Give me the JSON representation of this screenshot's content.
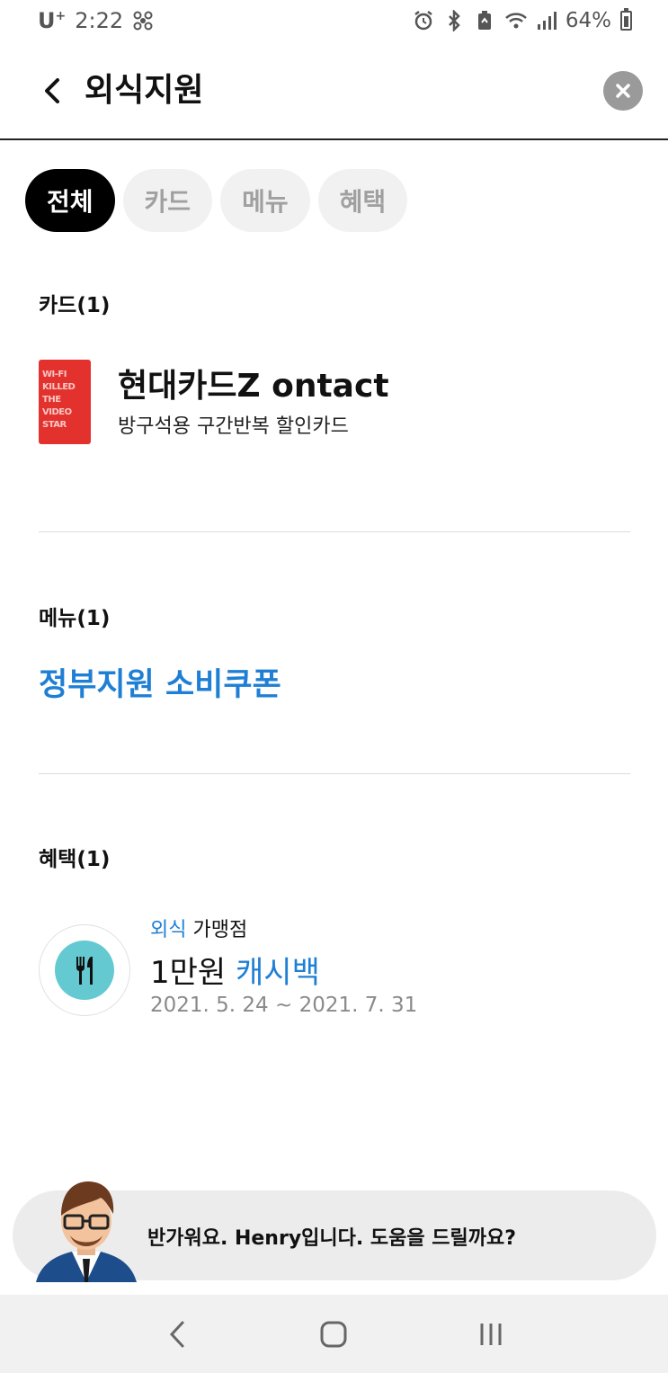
{
  "status_bar": {
    "carrier": "U",
    "carrier_sup": "+",
    "time": "2:22",
    "battery": "64%"
  },
  "header": {
    "title": "외식지원"
  },
  "tabs": [
    {
      "label": "전체",
      "active": true
    },
    {
      "label": "카드",
      "active": false
    },
    {
      "label": "메뉴",
      "active": false
    },
    {
      "label": "혜택",
      "active": false
    }
  ],
  "card_section": {
    "label": "카드(1)",
    "card_art_lines": [
      "WI-FI",
      "KILLED",
      "THE",
      "VIDEO",
      "STAR"
    ],
    "card_name": "현대카드Z ontact",
    "card_desc": "방구석용 구간반복 할인카드"
  },
  "menu_section": {
    "label": "메뉴(1)",
    "item": "정부지원 소비쿠폰"
  },
  "benefit_section": {
    "label": "혜택(1)",
    "category_highlight": "외식",
    "category_rest": " 가맹점",
    "amount": "1만원",
    "amount_highlight": " 캐시백",
    "dates": "2021. 5. 24 ~ 2021. 7. 31",
    "icon": "fork-knife-icon"
  },
  "chat": {
    "message": "반가워요. Henry입니다. 도움을 드릴까요?"
  },
  "colors": {
    "accent_blue": "#1f7fd4",
    "tab_active": "#000000",
    "card_red": "#e3312e",
    "benefit_icon_bg": "#64c9d1"
  }
}
